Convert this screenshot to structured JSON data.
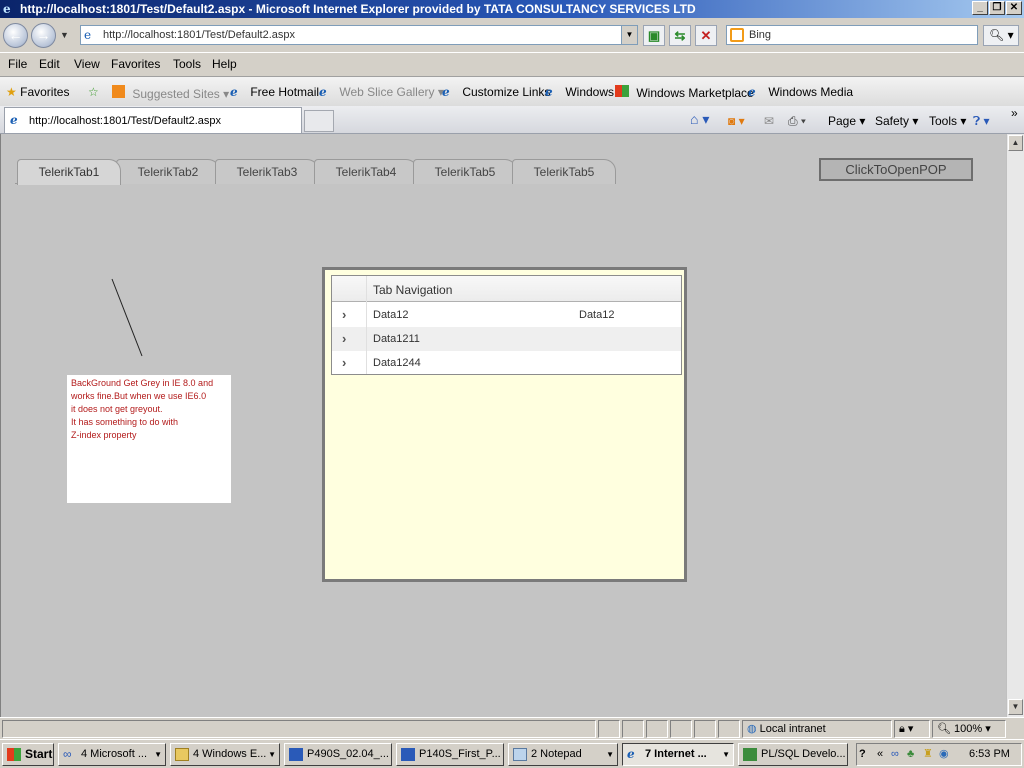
{
  "window": {
    "title": "http://localhost:1801/Test/Default2.aspx - Microsoft Internet Explorer provided by TATA CONSULTANCY SERVICES LTD",
    "minimize": "_",
    "restore": "❐",
    "close": "✕"
  },
  "address": {
    "url": "http://localhost:1801/Test/Default2.aspx",
    "search_placeholder": "Bing"
  },
  "menu": [
    "File",
    "Edit",
    "View",
    "Favorites",
    "Tools",
    "Help"
  ],
  "favorites": {
    "label": "Favorites",
    "items": [
      {
        "label": "Suggested Sites ▾",
        "icon": "suggested-sites-icon"
      },
      {
        "label": "Free Hotmail",
        "icon": "ie-page-icon"
      },
      {
        "label": "Web Slice Gallery ▾",
        "icon": "ie-page-icon"
      },
      {
        "label": "Customize Links",
        "icon": "ie-page-icon"
      },
      {
        "label": "Windows",
        "icon": "ie-page-icon"
      },
      {
        "label": "Windows Marketplace",
        "icon": "windows-flag-icon"
      },
      {
        "label": "Windows Media",
        "icon": "ie-page-icon"
      }
    ]
  },
  "browser_tab": {
    "label": "http://localhost:1801/Test/Default2.aspx"
  },
  "command_bar": {
    "page": "Page ▾",
    "safety": "Safety ▾",
    "tools": "Tools ▾",
    "more": "»"
  },
  "page": {
    "tabs": [
      "TelerikTab1",
      "TelerikTab2",
      "TelerikTab3",
      "TelerikTab4",
      "TelerikTab5",
      "TelerikTab5"
    ],
    "active_tab": "TelerikTab1",
    "popup_button": "ClickToOpenPOP",
    "note_lines": [
      "BackGround Get Grey in IE 8.0 and",
      "works fine.But when we use IE6.0",
      "it does not get greyout.",
      "It has something to do with",
      "Z-index property"
    ],
    "grid": {
      "header": "Tab Navigation",
      "rows": [
        {
          "col1": "Data12",
          "col2": "Data12"
        },
        {
          "col1": "Data1211",
          "col2": ""
        },
        {
          "col1": "Data1244",
          "col2": ""
        }
      ]
    }
  },
  "status": {
    "zone": "Local intranet",
    "zoom": "100%"
  },
  "taskbar": {
    "start": "Start",
    "items": [
      {
        "label": "4 Microsoft ...",
        "icon": "infinity-app-icon"
      },
      {
        "label": "4 Windows E...",
        "icon": "folder-icon"
      },
      {
        "label": "P490S_02.04_...",
        "icon": "word-doc-icon"
      },
      {
        "label": "P140S_First_P...",
        "icon": "word-doc-icon"
      },
      {
        "label": "2 Notepad",
        "icon": "notepad-icon"
      },
      {
        "label": "7 Internet ...",
        "icon": "ie-page-icon"
      },
      {
        "label": "PL/SQL Develo...",
        "icon": "plsql-icon"
      }
    ],
    "clock": "6:53 PM"
  }
}
